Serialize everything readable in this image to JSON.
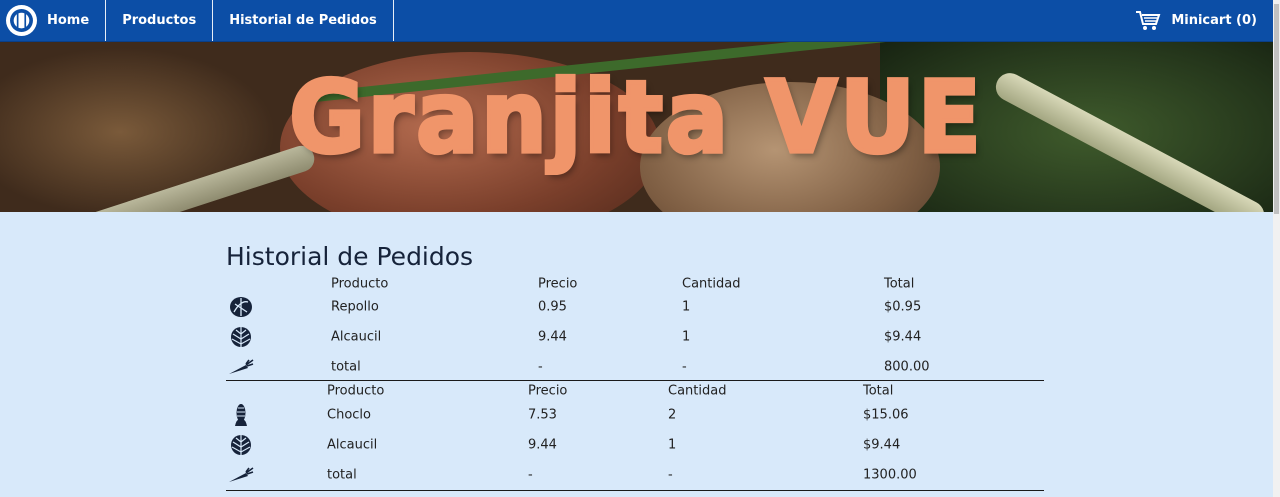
{
  "nav": {
    "home_label": "Home",
    "productos_label": "Productos",
    "historial_label": "Historial de Pedidos",
    "minicart_label": "Minicart (0)"
  },
  "banner": {
    "title": "Granjita VUE"
  },
  "page_title": "Historial de Pedidos",
  "columns": [
    "Producto",
    "Precio",
    "Cantidad",
    "Total"
  ],
  "orders": [
    {
      "rows": [
        {
          "icon": "cabbage-icon",
          "producto": "Repollo",
          "precio": "0.95",
          "cantidad": "1",
          "total": "$0.95"
        },
        {
          "icon": "artichoke-icon",
          "producto": "Alcaucil",
          "precio": "9.44",
          "cantidad": "1",
          "total": "$9.44"
        },
        {
          "icon": "carrot-icon",
          "producto": "total",
          "precio": "-",
          "cantidad": "-",
          "total": "800.00"
        }
      ]
    },
    {
      "rows": [
        {
          "icon": "corn-icon",
          "producto": "Choclo",
          "precio": "7.53",
          "cantidad": "2",
          "total": "$15.06"
        },
        {
          "icon": "artichoke-icon",
          "producto": "Alcaucil",
          "precio": "9.44",
          "cantidad": "1",
          "total": "$9.44"
        },
        {
          "icon": "carrot-icon",
          "producto": "total",
          "precio": "-",
          "cantidad": "-",
          "total": "1300.00"
        }
      ]
    },
    {
      "rows": []
    }
  ],
  "colors": {
    "navbar": "#0c4ea6",
    "page_background": "#d8e9fa",
    "banner_title": "#f0956a",
    "icon": "#16233a"
  }
}
